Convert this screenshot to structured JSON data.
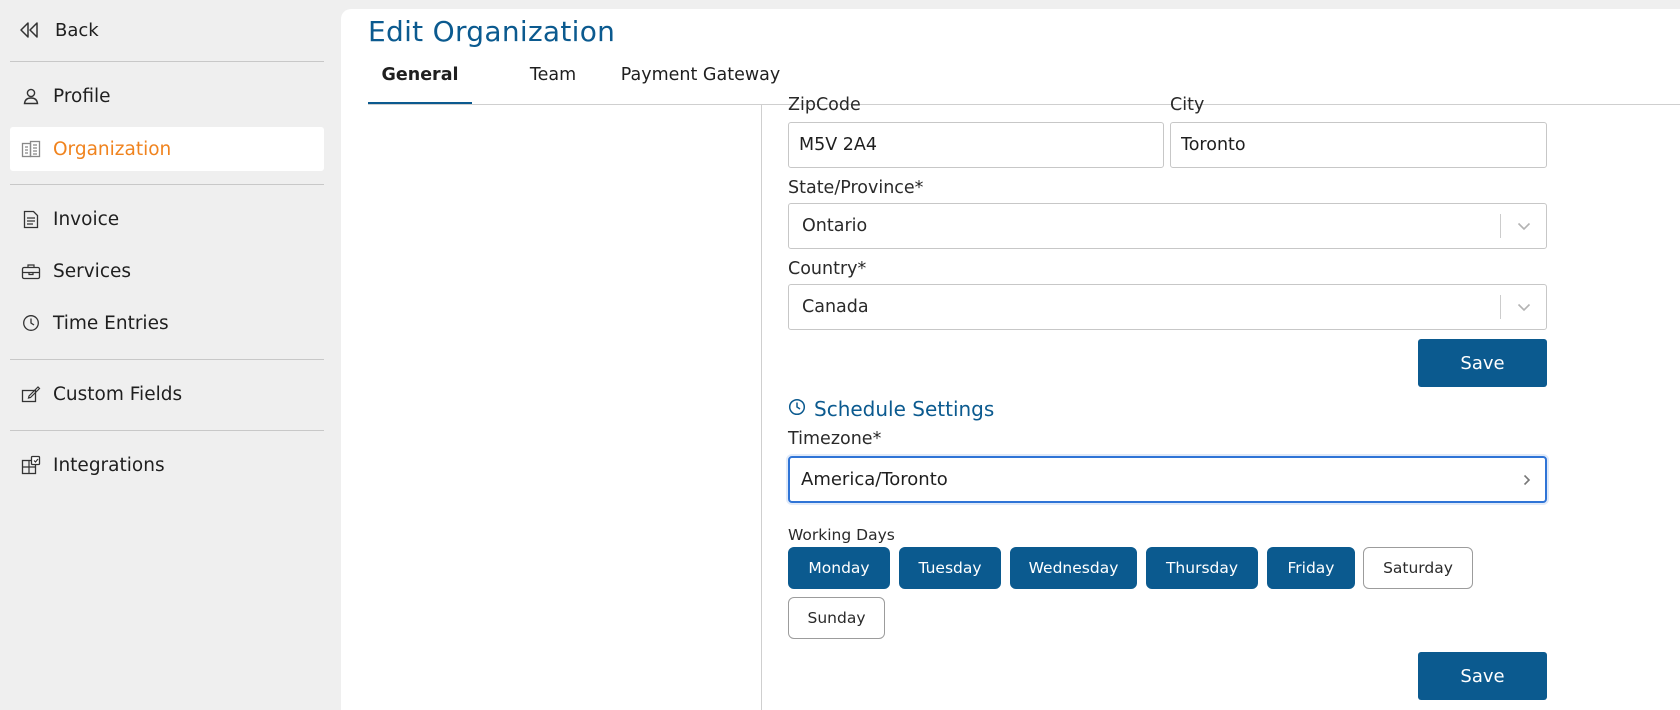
{
  "sidebar": {
    "back_label": "Back",
    "items": [
      {
        "label": "Profile",
        "icon": "person-icon",
        "active": false
      },
      {
        "label": "Organization",
        "icon": "building-icon",
        "active": true
      },
      {
        "label": "Invoice",
        "icon": "document-icon",
        "active": false
      },
      {
        "label": "Services",
        "icon": "briefcase-icon",
        "active": false
      },
      {
        "label": "Time Entries",
        "icon": "clock-icon",
        "active": false
      },
      {
        "label": "Custom Fields",
        "icon": "edit-field-icon",
        "active": false
      },
      {
        "label": "Integrations",
        "icon": "puzzle-icon",
        "active": false
      }
    ]
  },
  "header": {
    "title": "Edit Organization",
    "tabs": [
      {
        "label": "General",
        "active": true
      },
      {
        "label": "Team",
        "active": false
      },
      {
        "label": "Payment Gateway",
        "active": false
      }
    ]
  },
  "form": {
    "zipcode": {
      "label": "ZipCode",
      "value": "M5V 2A4"
    },
    "city": {
      "label": "City",
      "value": "Toronto"
    },
    "state": {
      "label": "State/Province*",
      "value": "Ontario"
    },
    "country": {
      "label": "Country*",
      "value": "Canada"
    },
    "save_label": "Save"
  },
  "schedule": {
    "title": "Schedule Settings",
    "timezone": {
      "label": "Timezone*",
      "value": "America/Toronto"
    },
    "working_days_label": "Working Days",
    "days": [
      {
        "label": "Monday",
        "selected": true
      },
      {
        "label": "Tuesday",
        "selected": true
      },
      {
        "label": "Wednesday",
        "selected": true
      },
      {
        "label": "Thursday",
        "selected": true
      },
      {
        "label": "Friday",
        "selected": true
      },
      {
        "label": "Saturday",
        "selected": false
      },
      {
        "label": "Sunday",
        "selected": false
      }
    ],
    "save_label": "Save"
  },
  "colors": {
    "accent": "#0b5a8f",
    "active_nav": "#f0831e",
    "focus_ring": "#2f74d6"
  }
}
